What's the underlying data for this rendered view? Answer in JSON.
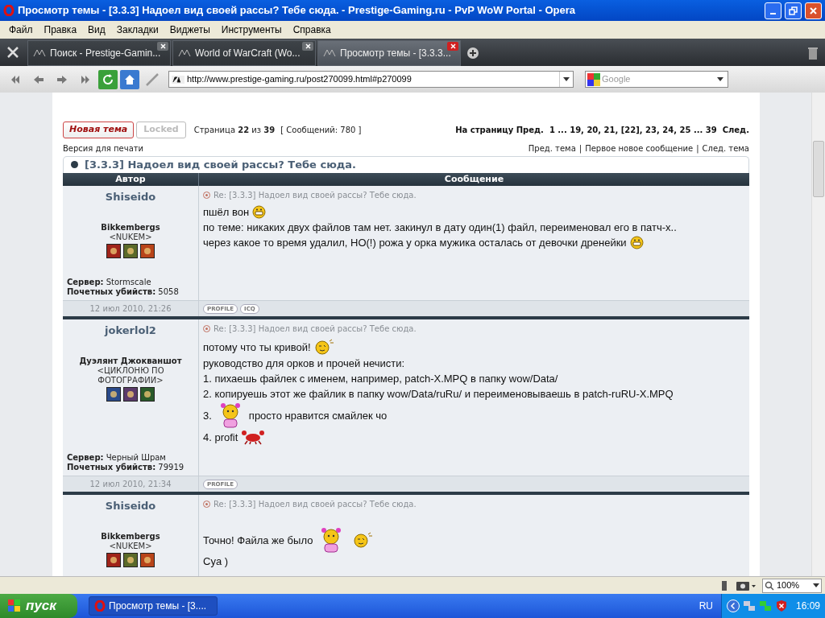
{
  "window": {
    "title": "Просмотр темы - [3.3.3] Надоел вид своей рассы? Тебе сюда. - Prestige-Gaming.ru - PvP WoW Portal - Opera"
  },
  "menu": [
    "Файл",
    "Правка",
    "Вид",
    "Закладки",
    "Виджеты",
    "Инструменты",
    "Справка"
  ],
  "tabs": [
    {
      "label": "Поиск - Prestige-Gamin...",
      "selected": false
    },
    {
      "label": "World of WarCraft (Wo...",
      "selected": false
    },
    {
      "label": "Просмотр темы - [3.3.3...",
      "selected": true
    }
  ],
  "address": {
    "value": "http://www.prestige-gaming.ru/post270099.html#p270099"
  },
  "search": {
    "placeholder": "Google"
  },
  "topic": {
    "new_topic": "Новая тема",
    "locked": "Locked",
    "page_info": "Страница **22** из **39**",
    "count": "[ Сообщений: 780 ]",
    "pagination": "На страницу Пред.  1 ... 19, 20, 21, [22], 23, 24, 25 ... 39  След.",
    "print": "Версия для печати",
    "nav_links": [
      "Пред. тема",
      "Первое новое сообщение",
      "След. тема"
    ],
    "separator": "|",
    "title": "[3.3.3] Надоел вид своей рассы? Тебе сюда."
  },
  "table": {
    "columns": [
      "Автор",
      "Сообщение"
    ]
  },
  "posts": [
    {
      "author": "Shiseido",
      "rank": "Bikkembergs",
      "guild": "<NUKEM>",
      "badges": [
        {
          "color": "#a0241a"
        },
        {
          "color": "#5a6a2a"
        },
        {
          "color": "#b8441a"
        }
      ],
      "server": "**Сервер:** Stormscale",
      "kills": "**Почетных убийств:** 5058",
      "date": "12 июл 2010, 21:26",
      "subject": "Re: [3.3.3] Надоел вид своей рассы? Тебе сюда.",
      "buttons": [
        "PROFILE",
        "ICQ"
      ],
      "lines": [
        [
          {
            "kind": "text",
            "text": "пшёл вон"
          },
          {
            "kind": "grin"
          }
        ],
        [
          {
            "kind": "text",
            "text": "по теме: никаких двух файлов там нет. закинул в дату один(1) файл, переименовал его в патч-х.."
          }
        ],
        [
          {
            "kind": "text",
            "text": "через какое то время удалил, НО(!) рожа у орка мужика осталась от девочки дренейки"
          },
          {
            "kind": "grin"
          }
        ]
      ]
    },
    {
      "author": "jokerlol2",
      "rank": "Дуэлянт Джокваншот",
      "guild": "<ЦИКЛОНЮ ПО ФОТОГРАФИИ>",
      "badges": [
        {
          "color": "#2a4a8a"
        },
        {
          "color": "#5a3a6a"
        },
        {
          "color": "#2a5a2a"
        }
      ],
      "server": "**Сервер:** Черный Шрам",
      "kills": "**Почетных убийств:** 79919",
      "date": "12 июл 2010, 21:34",
      "subject": "Re: [3.3.3] Надоел вид своей рассы? Тебе сюда.",
      "buttons": [
        "PROFILE"
      ],
      "lines": [
        [
          {
            "kind": "text",
            "text": "потому что ты кривой!"
          },
          {
            "kind": "wink"
          }
        ],
        [
          {
            "kind": "text",
            "text": "руководство для орков и прочей нечисти:"
          }
        ],
        [
          {
            "kind": "text",
            "text": "1. пихаешь файлек с именем, например, patch-X.MPQ в папку wow/Data/"
          }
        ],
        [
          {
            "kind": "text",
            "text": "2. копируешь этот же файлик в папку wow/Data/ruRu/ и переименовываешь в patch-ruRU-X.MPQ"
          }
        ],
        [
          {
            "kind": "text",
            "text": "3."
          },
          {
            "kind": "girl"
          },
          {
            "kind": "text",
            "text": "просто нравится смайлек чо"
          }
        ],
        [
          {
            "kind": "text",
            "text": "4. profit"
          },
          {
            "kind": "crab"
          }
        ]
      ]
    },
    {
      "author": "Shiseido",
      "rank": "Bikkembergs",
      "guild": "<NUKEM>",
      "badges": [
        {
          "color": "#a0241a"
        },
        {
          "color": "#5a6a2a"
        },
        {
          "color": "#b8441a"
        }
      ],
      "subject": "Re: [3.3.3] Надоел вид своей рассы? Тебе сюда.",
      "lines": [
        [
          {
            "kind": "text",
            "text": "Точно! Файла же было"
          },
          {
            "kind": "girl"
          },
          {
            "kind": "wink"
          }
        ],
        [
          {
            "kind": "text",
            "text": "Cya )"
          }
        ]
      ]
    }
  ],
  "status": {
    "zoom": "100%"
  },
  "taskbar": {
    "start": "пуск",
    "task": "Просмотр темы - [3....",
    "lang": "RU",
    "time": "16:09"
  }
}
